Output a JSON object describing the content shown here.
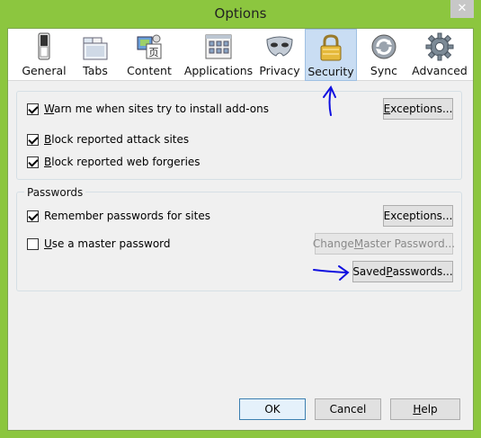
{
  "window": {
    "title": "Options",
    "close_glyph": "✕"
  },
  "toolbar": {
    "panes": [
      {
        "label": "General",
        "icon": "switch-icon"
      },
      {
        "label": "Tabs",
        "icon": "tabs-icon"
      },
      {
        "label": "Content",
        "icon": "content-icon"
      },
      {
        "label": "Applications",
        "icon": "applications-icon"
      },
      {
        "label": "Privacy",
        "icon": "mask-icon"
      },
      {
        "label": "Security",
        "icon": "padlock-icon"
      },
      {
        "label": "Sync",
        "icon": "sync-icon"
      },
      {
        "label": "Advanced",
        "icon": "gear-icon"
      }
    ],
    "selected": "Security"
  },
  "addons": {
    "warn": {
      "pre": "",
      "u": "W",
      "post": "arn me when sites try to install add-ons",
      "checked": true
    },
    "exceptions_button": {
      "pre": "",
      "u": "E",
      "post": "xceptions..."
    },
    "attack": {
      "pre": "",
      "u": "B",
      "post": "lock reported attack sites",
      "checked": true
    },
    "forgeries": {
      "pre": "",
      "u": "B",
      "post": "lock reported web forgeries",
      "checked": true
    }
  },
  "passwords": {
    "group_label": "Passwords",
    "remember": {
      "pre": "Remember passwords for sites",
      "u": "",
      "post": "",
      "checked": true
    },
    "exceptions_button": {
      "pre": "Exceptions...",
      "u": "",
      "post": ""
    },
    "master": {
      "pre": "",
      "u": "U",
      "post": "se a master password",
      "checked": false
    },
    "change_master_button": {
      "pre": "Change ",
      "u": "M",
      "post": "aster Password..."
    },
    "saved_button": {
      "pre": "Saved ",
      "u": "P",
      "post": "asswords..."
    }
  },
  "footer": {
    "ok": "OK",
    "cancel": "Cancel",
    "help": {
      "pre": "",
      "u": "H",
      "post": "elp"
    }
  },
  "annotations": {
    "arrow_color": "#1010e0"
  },
  "colors": {
    "window_frame": "#8cc63f",
    "selected_pane": "#c9ddf3",
    "client_bg": "#f0f0f0"
  }
}
